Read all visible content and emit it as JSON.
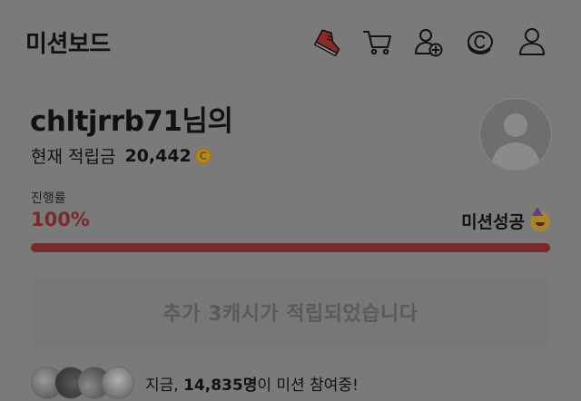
{
  "header": {
    "title": "미션보드",
    "icons": [
      "shoe-icon",
      "cart-icon",
      "add-user-icon",
      "coin-c-icon",
      "user-icon"
    ]
  },
  "user": {
    "greeting_name": "chltjrrb71님의",
    "balance_label": "현재 적립금",
    "balance_value": "20,442",
    "coin_symbol": "C"
  },
  "progress": {
    "label": "진행률",
    "value": "100%",
    "fraction": 1.0,
    "status": "미션성공",
    "accent_color": "#7a2a2a"
  },
  "message": {
    "text": "추가 3캐시가 적립되었습니다"
  },
  "participants": {
    "prefix": "지금,",
    "count": "14,835명",
    "suffix": "이 미션 참여중!"
  }
}
